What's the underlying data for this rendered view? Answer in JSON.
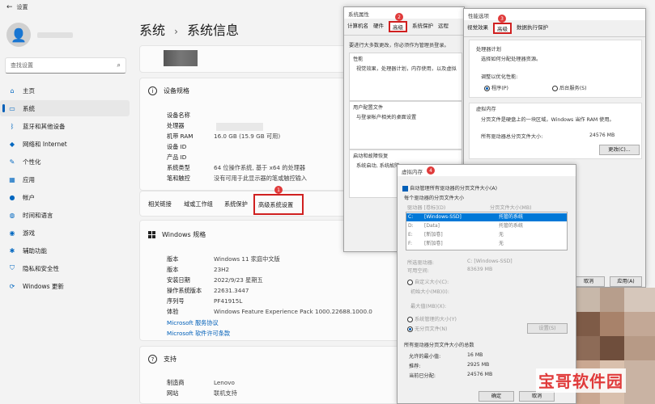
{
  "window_title": "设置",
  "sidebar": {
    "search_placeholder": "查找设置",
    "items": [
      {
        "label": "主页",
        "icon": "home-icon",
        "glyph": "⌂"
      },
      {
        "label": "系统",
        "icon": "system-icon",
        "glyph": "▭"
      },
      {
        "label": "蓝牙和其他设备",
        "icon": "bluetooth-icon",
        "glyph": "ᛒ"
      },
      {
        "label": "网络和 Internet",
        "icon": "wifi-icon",
        "glyph": "◆"
      },
      {
        "label": "个性化",
        "icon": "brush-icon",
        "glyph": "✎"
      },
      {
        "label": "应用",
        "icon": "apps-icon",
        "glyph": "▦"
      },
      {
        "label": "帐户",
        "icon": "account-icon",
        "glyph": "●"
      },
      {
        "label": "时间和语言",
        "icon": "globe-icon",
        "glyph": "◍"
      },
      {
        "label": "游戏",
        "icon": "gamepad-icon",
        "glyph": "◉"
      },
      {
        "label": "辅助功能",
        "icon": "accessibility-icon",
        "glyph": "✱"
      },
      {
        "label": "隐私和安全性",
        "icon": "shield-icon",
        "glyph": "⛉"
      },
      {
        "label": "Windows 更新",
        "icon": "update-icon",
        "glyph": "⟳"
      }
    ]
  },
  "breadcrumb": {
    "parent": "系统",
    "sep": "›",
    "current": "系统信息"
  },
  "device_specs": {
    "title": "设备规格",
    "rows": [
      {
        "k": "设备名称",
        "v": ""
      },
      {
        "k": "处理器",
        "v": ""
      },
      {
        "k": "机带 RAM",
        "v": "16.0 GB (15.9 GB 可用)"
      },
      {
        "k": "设备 ID",
        "v": ""
      },
      {
        "k": "产品 ID",
        "v": ""
      },
      {
        "k": "系统类型",
        "v": "64 位操作系统, 基于 x64 的处理器"
      },
      {
        "k": "笔和触控",
        "v": "没有可用于此显示器的笔或触控输入"
      }
    ]
  },
  "related_links": {
    "label": "相关链接",
    "links": [
      "域或工作组",
      "系统保护",
      "高级系统设置"
    ],
    "badge": "1"
  },
  "windows_specs": {
    "title": "Windows 规格",
    "rows": [
      {
        "k": "版本",
        "v": "Windows 11 家庭中文版"
      },
      {
        "k": "版本",
        "v": "23H2"
      },
      {
        "k": "安装日期",
        "v": "2022/9/23 星期五"
      },
      {
        "k": "操作系统版本",
        "v": "22631.3447"
      },
      {
        "k": "序列号",
        "v": "PF41915L"
      },
      {
        "k": "体验",
        "v": "Windows Feature Experience Pack 1000.22688.1000.0"
      }
    ],
    "links": [
      "Microsoft 服务协议",
      "Microsoft 软件许可条款"
    ]
  },
  "support": {
    "title": "支持",
    "rows": [
      {
        "k": "制造商",
        "v": "Lenovo"
      },
      {
        "k": "网站",
        "v": "联机支持"
      }
    ]
  },
  "sysprops": {
    "title": "系统属性",
    "tabs": [
      "计算机名",
      "硬件",
      "高级",
      "系统保护",
      "远程"
    ],
    "badge": "2",
    "admin_note": "要进行大多数更改，你必须作为管理员登录。",
    "perf_label": "性能",
    "perf_desc": "视觉效果，处理器计划，内存使用，以及虚拟",
    "profile_label": "用户配置文件",
    "profile_desc": "与登录帐户相关的桌面设置",
    "startup_label": "启动和故障恢复",
    "startup_desc": "系统启动, 系统故障"
  },
  "perfopts": {
    "title": "性能选项",
    "tabs": [
      "视觉效果",
      "高级",
      "数据执行保护"
    ],
    "badge": "3",
    "sched_label": "处理器计划",
    "sched_desc": "选择如何分配处理器资源。",
    "adjust_label": "调整以优化性能:",
    "opt_programs": "程序(P)",
    "opt_services": "后台服务(S)",
    "vm_label": "虚拟内存",
    "vm_desc": "分页文件是硬盘上的一块区域，Windows 当作 RAM 使用。",
    "total_label": "所有驱动器总分页文件大小:",
    "total_value": "24576 MB",
    "change_btn": "更改(C)...",
    "cancel_btn": "取消",
    "apply_btn": "应用(A)"
  },
  "vmem": {
    "title": "虚拟内存",
    "badge": "4",
    "auto_manage": "自动管理所有驱动器的分页文件大小(A)",
    "per_drive": "每个驱动器的分页文件大小",
    "col_drive": "驱动器 [卷标](D)",
    "col_size": "分页文件大小(MB)",
    "drives": [
      {
        "d": "C:",
        "label": "[Windows-SSD]",
        "size": "托管的系统"
      },
      {
        "d": "D:",
        "label": "[Data]",
        "size": "托管的系统"
      },
      {
        "d": "E:",
        "label": "[新加卷]",
        "size": "无"
      },
      {
        "d": "F:",
        "label": "[新加卷]",
        "size": "无"
      }
    ],
    "sel_drive_label": "所选驱动器:",
    "sel_drive_value": "C: [Windows-SSD]",
    "space_label": "可用空间:",
    "space_value": "83639 MB",
    "custom": "自定义大小(C):",
    "initial": "初始大小(MB)(I):",
    "max": "最大值(MB)(X):",
    "system_managed": "系统管理的大小(Y)",
    "no_paging": "无分页文件(N)",
    "set_btn": "设置(S)",
    "total_title": "所有驱动器分页文件大小的总数",
    "min_label": "允许的最小值:",
    "min_value": "16 MB",
    "rec_label": "推荐:",
    "rec_value": "2925 MB",
    "cur_label": "当前已分配:",
    "cur_value": "24576 MB",
    "ok_btn": "确定",
    "cancel_btn": "取消"
  },
  "watermark": "宝哥软件园"
}
